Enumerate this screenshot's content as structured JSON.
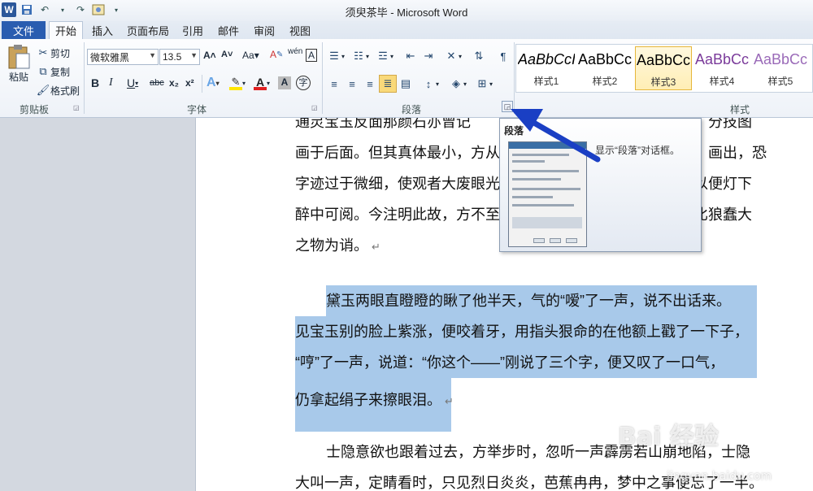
{
  "window": {
    "title": "须臾茶毕 - Microsoft Word"
  },
  "qat": {
    "icons": [
      "word-icon",
      "save-icon",
      "undo-icon",
      "redo-icon",
      "customize-icon"
    ]
  },
  "tabs": [
    "文件",
    "开始",
    "插入",
    "页面布局",
    "引用",
    "邮件",
    "审阅",
    "视图"
  ],
  "clipboard": {
    "paste": "粘贴",
    "cut": "剪切",
    "copy": "复制",
    "format_painter": "格式刷",
    "group": "剪贴板"
  },
  "font": {
    "name": "微软雅黑",
    "size": "13.5",
    "group": "字体",
    "bold": "B",
    "italic": "I",
    "underline": "U",
    "strike": "abc",
    "sub": "x₂",
    "sup": "x²",
    "grow": "A˄",
    "shrink": "A˅",
    "case": "Aa",
    "clear": "A",
    "phonetic": "wén",
    "font_color_letter": "A",
    "highlight_letter": "A"
  },
  "paragraph": {
    "group": "段落"
  },
  "styles": {
    "group": "样式",
    "items": [
      {
        "sample": "AaBbCcI",
        "name": "样式1",
        "color": "#222222",
        "italic": true
      },
      {
        "sample": "AaBbCc",
        "name": "样式2",
        "color": "#222222",
        "italic": false
      },
      {
        "sample": "AaBbCc",
        "name": "样式3",
        "color": "#222222",
        "italic": false
      },
      {
        "sample": "AaBbCc",
        "name": "样式4",
        "color": "#7a3a9a",
        "italic": false
      },
      {
        "sample": "AaBbCc",
        "name": "样式5",
        "color": "#9a6ab8",
        "italic": false
      }
    ]
  },
  "popup": {
    "title": "段落",
    "description": "显示“段落”对话框。"
  },
  "document": {
    "lines_p1": [
      "通灵宝玉反面那颜石亦曾记",
      "画于后面。但其真体最小，方从",
      "字迹过于微细，使观者大废眼光",
      "醉中可阅。今注明此故，方不至",
      "之物为诮。"
    ],
    "lines_p1_right": [
      "分技图",
      "画出，恐",
      "以便灯下",
      "比狼蠢大"
    ],
    "lines_p2": [
      "黛玉两眼直瞪瞪的瞅了他半天，气的“嗳”了一声，说不出话来。",
      "见宝玉别的脸上紫涨，便咬着牙，用指头狠命的在他额上戳了一下子，",
      "“哼”了一声，说道：“你这个——”刚说了三个字，便又叹了一口气，",
      "仍拿起绢子来擦眼泪。"
    ],
    "lines_p3": [
      "士隐意欲也跟着过去，方举步时，忽听一声霹雳若山崩地陷，士隐",
      "大叫一声，定睛看时，只见烈日炎炎，芭蕉冉冉，梦中之事便忘了一半。"
    ]
  },
  "watermark": {
    "main": "Bai 经验",
    "sub": "jingyan.baidu.com"
  },
  "colors": {
    "file_tab": "#2a5db0",
    "selection": "#a8c9ea",
    "arrow": "#1a3fc4"
  }
}
